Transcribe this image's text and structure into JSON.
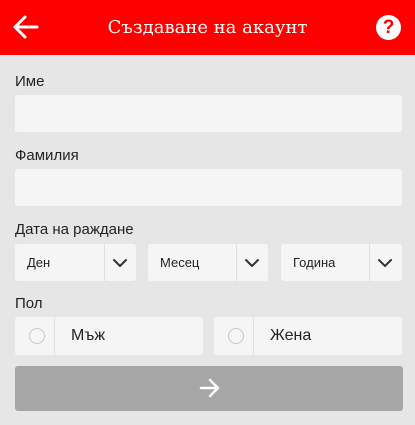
{
  "colors": {
    "accent": "#ff0000",
    "field_bg": "#f5f5f5",
    "page_bg": "#e6e6e6",
    "submit_bg": "#a6a6a6"
  },
  "header": {
    "title": "Създаване на акаунт",
    "back_icon": "arrow-left-icon",
    "help_icon": "question-circle-icon",
    "help_glyph": "?"
  },
  "form": {
    "first_name": {
      "label": "Име",
      "value": ""
    },
    "last_name": {
      "label": "Фамилия",
      "value": ""
    },
    "birth_date": {
      "label": "Дата на раждане",
      "day": "Ден",
      "month": "Месец",
      "year": "Година"
    },
    "gender": {
      "label": "Пол",
      "male": "Мъж",
      "female": "Жена"
    },
    "submit_icon": "arrow-right-icon"
  }
}
